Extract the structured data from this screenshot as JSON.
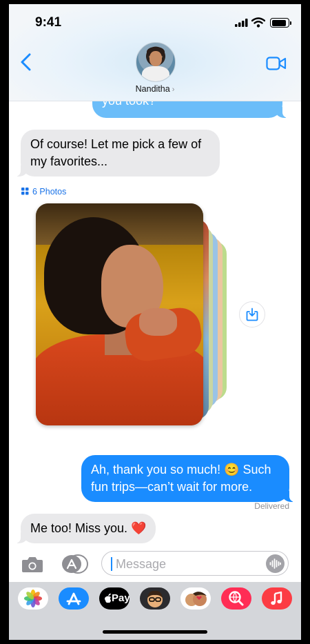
{
  "status_bar": {
    "time": "9:41"
  },
  "header": {
    "contact_name": "Nanditha",
    "chevron": "›"
  },
  "messages": {
    "partial_out": "you took?",
    "reply_in": "Of course! Let me pick a few of my favorites...",
    "photos_label": "6 Photos",
    "thanks_out": "Ah, thank you so much! 😊 Such fun trips—can’t wait for more.",
    "delivered": "Delivered",
    "last_in": "Me too! Miss you. ❤️"
  },
  "composer": {
    "placeholder": "Message"
  },
  "app_drawer": {
    "items": [
      "photos-app",
      "app-store",
      "apple-pay",
      "memoji",
      "memoji-stickers",
      "image-search",
      "music"
    ],
    "pay_label": "Pay"
  },
  "colors": {
    "outgoing_bubble": "#1a8cff",
    "incoming_bubble": "#e9e9eb",
    "accent": "#1a73e8",
    "drawer_bg": "#d4d6da"
  }
}
